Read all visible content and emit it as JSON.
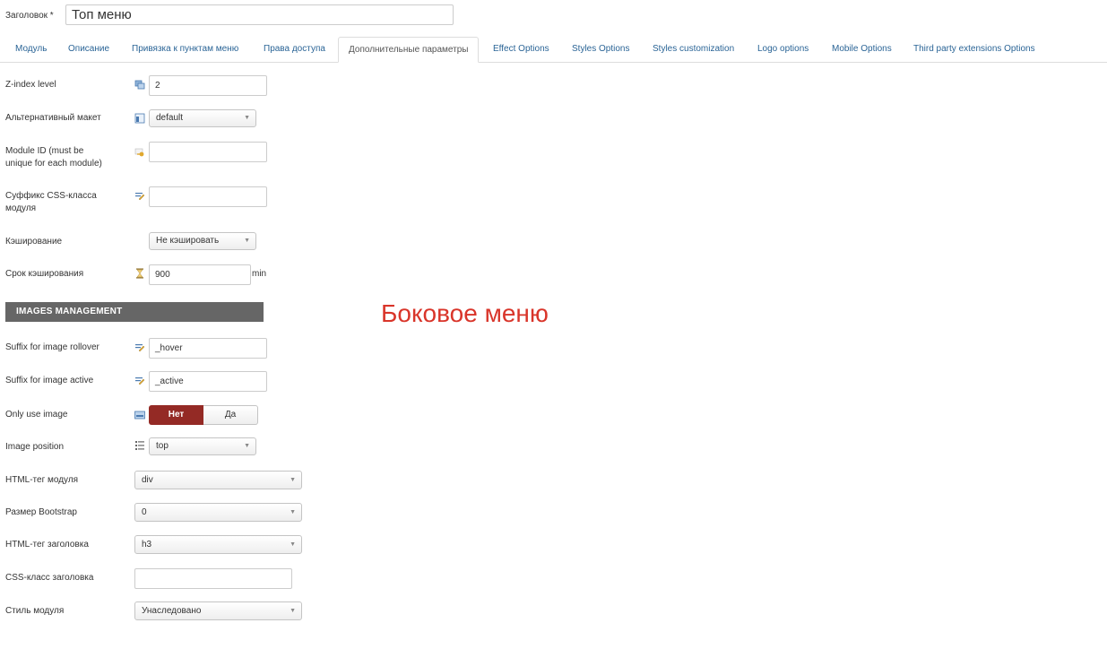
{
  "header": {
    "title_label": "Заголовок *",
    "title_value": "Топ меню"
  },
  "tabs": [
    {
      "label": "Модуль"
    },
    {
      "label": "Описание"
    },
    {
      "label": "Привязка к пунктам меню"
    },
    {
      "label": "Права доступа"
    },
    {
      "label": "Дополнительные параметры",
      "active": true
    },
    {
      "label": "Effect Options"
    },
    {
      "label": "Styles Options"
    },
    {
      "label": "Styles customization"
    },
    {
      "label": "Logo options"
    },
    {
      "label": "Mobile Options"
    },
    {
      "label": "Third party extensions Options"
    }
  ],
  "fields": {
    "zindex": {
      "label": "Z-index level",
      "value": "2"
    },
    "layout": {
      "label": "Альтернативный макет",
      "value": "default"
    },
    "module_id": {
      "label_line1": "Module ID (must be",
      "label_line2": "unique for each module)",
      "value": ""
    },
    "css_suffix": {
      "label_line1": "Суффикс CSS-класса",
      "label_line2": "модуля",
      "value": ""
    },
    "caching": {
      "label": "Кэширование",
      "value": "Не кэшировать"
    },
    "cache_time": {
      "label": "Срок кэширования",
      "value": "900",
      "unit": "min"
    }
  },
  "images_section": {
    "header": "IMAGES MANAGEMENT",
    "rollover": {
      "label": "Suffix for image rollover",
      "value": "_hover"
    },
    "active": {
      "label": "Suffix for image active",
      "value": "_active"
    },
    "only_image": {
      "label": "Only use image",
      "option_no": "Нет",
      "option_yes": "Да",
      "selected": "Нет"
    },
    "position": {
      "label": "Image position",
      "value": "top"
    }
  },
  "module_settings": {
    "html_tag": {
      "label": "HTML-тег модуля",
      "value": "div"
    },
    "bootstrap": {
      "label": "Размер Bootstrap",
      "value": "0"
    },
    "header_tag": {
      "label": "HTML-тег заголовка",
      "value": "h3"
    },
    "header_class": {
      "label": "CSS-класс заголовка",
      "value": ""
    },
    "module_style": {
      "label": "Стиль модуля",
      "value": "Унаследовано"
    }
  },
  "annotation": "Боковое меню",
  "colors": {
    "accent_red": "#942a25",
    "annotation_red": "#d9352a",
    "link_blue": "#2a6496",
    "section_gray": "#666666"
  }
}
